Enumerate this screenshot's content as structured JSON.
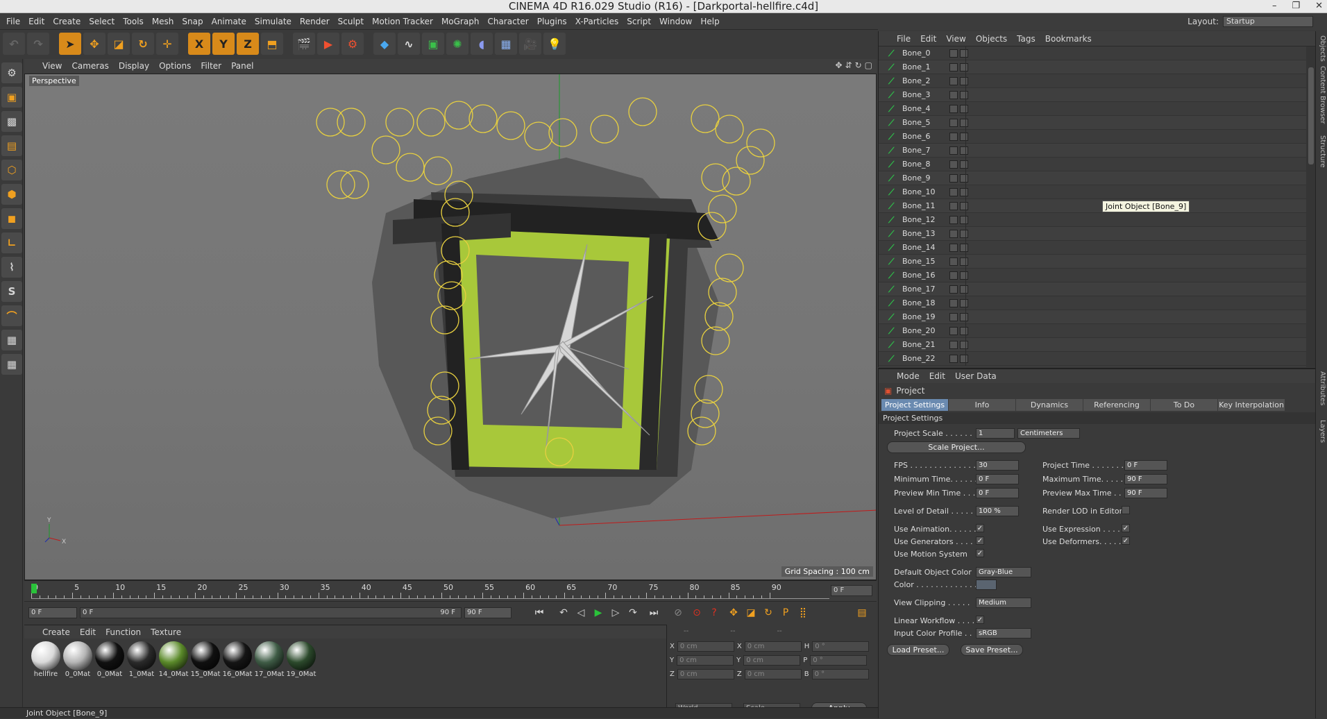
{
  "window": {
    "title": "CINEMA 4D R16.029 Studio (R16) - [Darkportal-hellfire.c4d]",
    "minimize": "–",
    "restore": "❐",
    "close": "✕"
  },
  "menu": [
    "File",
    "Edit",
    "Create",
    "Select",
    "Tools",
    "Mesh",
    "Snap",
    "Animate",
    "Simulate",
    "Render",
    "Sculpt",
    "Motion Tracker",
    "MoGraph",
    "Character",
    "Plugins",
    "X-Particles",
    "Script",
    "Window",
    "Help"
  ],
  "layout": {
    "label": "Layout:",
    "value": "Startup"
  },
  "viewport": {
    "menu": [
      "View",
      "Cameras",
      "Display",
      "Options",
      "Filter",
      "Panel"
    ],
    "camera": "Perspective",
    "grid_spacing": "Grid Spacing : 100 cm"
  },
  "timeline": {
    "ticks": [
      "0",
      "5",
      "10",
      "15",
      "20",
      "25",
      "30",
      "35",
      "40",
      "45",
      "50",
      "55",
      "60",
      "65",
      "70",
      "75",
      "80",
      "85",
      "90"
    ],
    "current_frame": "0 F",
    "start": "0 F",
    "range_start": "0 F",
    "range_end": "90 F",
    "end": "90 F"
  },
  "material_manager": {
    "menu": [
      "Create",
      "Edit",
      "Function",
      "Texture"
    ],
    "materials": [
      {
        "name": "hellfire",
        "color": "#d9d9d9"
      },
      {
        "name": "0_0Mat",
        "color": "#b5b5b5"
      },
      {
        "name": "0_0Mat",
        "color": "#111111"
      },
      {
        "name": "1_0Mat",
        "color": "#2a2a2a"
      },
      {
        "name": "14_0Mat",
        "color": "#5b8a2a"
      },
      {
        "name": "15_0Mat",
        "color": "#101010"
      },
      {
        "name": "16_0Mat",
        "color": "#151515"
      },
      {
        "name": "17_0Mat",
        "color": "#3f5c46"
      },
      {
        "name": "19_0Mat",
        "color": "#2c4a2c"
      }
    ]
  },
  "coordinates": {
    "header": [
      "--",
      "--",
      "--"
    ],
    "rows": [
      {
        "a": "X",
        "av": "0 cm",
        "b": "X",
        "bv": "0 cm",
        "c": "H",
        "cv": "0 °"
      },
      {
        "a": "Y",
        "av": "0 cm",
        "b": "Y",
        "bv": "0 cm",
        "c": "P",
        "cv": "0 °"
      },
      {
        "a": "Z",
        "av": "0 cm",
        "b": "Z",
        "bv": "0 cm",
        "c": "B",
        "cv": "0 °"
      }
    ],
    "mode": "World",
    "scale": "Scale",
    "apply": "Apply"
  },
  "status": "Joint Object [Bone_9]",
  "objects": {
    "menu": [
      "File",
      "Edit",
      "View",
      "Objects",
      "Tags",
      "Bookmarks"
    ],
    "items": [
      "Bone_0",
      "Bone_1",
      "Bone_2",
      "Bone_3",
      "Bone_4",
      "Bone_5",
      "Bone_6",
      "Bone_7",
      "Bone_8",
      "Bone_9",
      "Bone_10",
      "Bone_11",
      "Bone_12",
      "Bone_13",
      "Bone_14",
      "Bone_15",
      "Bone_16",
      "Bone_17",
      "Bone_18",
      "Bone_19",
      "Bone_20",
      "Bone_21",
      "Bone_22"
    ],
    "tooltip": "Joint Object [Bone_9]"
  },
  "attributes": {
    "menu": [
      "Mode",
      "Edit",
      "User Data"
    ],
    "title": "Project",
    "tabs": [
      "Project Settings",
      "Info",
      "Dynamics",
      "Referencing",
      "To Do",
      "Key Interpolation"
    ],
    "section": "Project Settings",
    "project_scale": {
      "label": "Project Scale . . . . . .",
      "value": "1",
      "unit": "Centimeters"
    },
    "scale_project": "Scale Project...",
    "fps": {
      "label": "FPS . . . . . . . . . . . . . . .",
      "value": "30"
    },
    "project_time": {
      "label": "Project Time . . . . . . . .",
      "value": "0 F"
    },
    "min_time": {
      "label": "Minimum Time. . . . . .",
      "value": "0 F"
    },
    "max_time": {
      "label": "Maximum Time. . . . . .",
      "value": "90 F"
    },
    "preview_min": {
      "label": "Preview Min Time . . .",
      "value": "0 F"
    },
    "preview_max": {
      "label": "Preview Max Time . . .",
      "value": "90 F"
    },
    "lod": {
      "label": "Level of Detail . . . . .",
      "value": "100 %"
    },
    "render_lod": "Render LOD in Editor",
    "use_animation": "Use Animation. . . . . .",
    "use_expression": "Use Expression . . . . .",
    "use_generators": "Use Generators . . . . .",
    "use_deformers": "Use Deformers. . . . . .",
    "use_motion": "Use Motion System",
    "default_color": {
      "label": "Default Object Color",
      "value": "Gray-Blue"
    },
    "color": "Color . . . . . . . . . . . . . .",
    "view_clipping": {
      "label": "View Clipping . . . . .",
      "value": "Medium"
    },
    "linear": "Linear Workflow . . . .",
    "input_profile": {
      "label": "Input Color Profile . .",
      "value": "sRGB"
    },
    "load_preset": "Load Preset...",
    "save_preset": "Save Preset..."
  },
  "side_tabs": [
    "Objects",
    "Content Browser",
    "Structure",
    "Attributes",
    "Layers"
  ],
  "accent_color": "#6a8ab0"
}
